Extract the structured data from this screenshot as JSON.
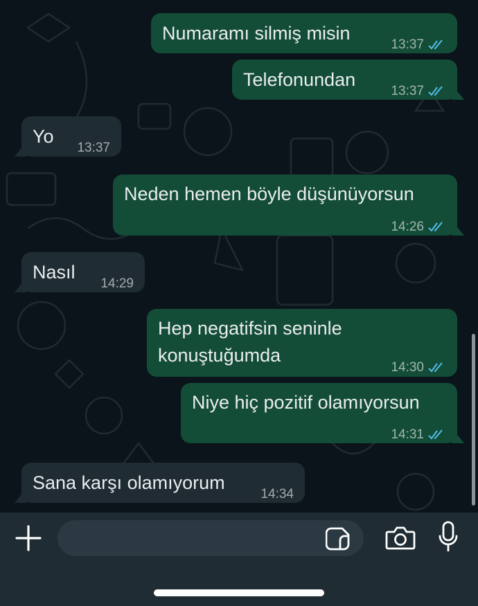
{
  "messages": [
    {
      "direction": "out",
      "text": "Numaramı silmiş misin",
      "time": "13:37",
      "status": "read"
    },
    {
      "direction": "out",
      "text": "Telefonundan",
      "time": "13:37",
      "status": "read"
    },
    {
      "direction": "in",
      "text": "Yo",
      "time": "13:37"
    },
    {
      "direction": "out",
      "text": "Neden hemen böyle düşünüyorsun",
      "time": "14:26",
      "status": "read"
    },
    {
      "direction": "in",
      "text": "Nasıl",
      "time": "14:29"
    },
    {
      "direction": "out",
      "text_line1": "Hep negatifsin seninle",
      "text_line2": "konuştuğumda",
      "time": "14:30",
      "status": "read"
    },
    {
      "direction": "out",
      "text": "Niye hiç pozitif olamıyorsun",
      "time": "14:31",
      "status": "read"
    },
    {
      "direction": "in",
      "text": "Sana karşı olamıyorum",
      "time": "14:34"
    }
  ],
  "composer": {
    "message_value": "",
    "icons": [
      "plus-icon",
      "sticker-icon",
      "camera-icon",
      "microphone-icon"
    ]
  },
  "colors": {
    "background": "#0b141a",
    "outgoing_bubble": "#144d37",
    "incoming_bubble": "#1f2c33",
    "read_tick": "#53bdeb"
  }
}
